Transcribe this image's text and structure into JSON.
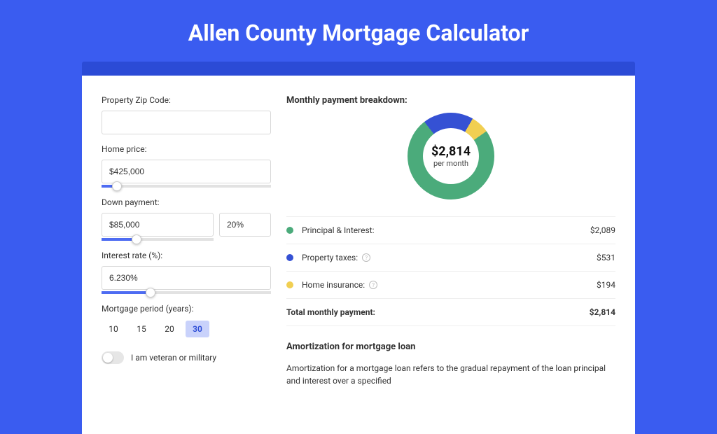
{
  "title": "Allen County Mortgage Calculator",
  "form": {
    "zip": {
      "label": "Property Zip Code:",
      "value": ""
    },
    "home_price": {
      "label": "Home price:",
      "value": "$425,000",
      "slider_pct": 9
    },
    "down_payment": {
      "label": "Down payment:",
      "amount": "$85,000",
      "percent": "20%",
      "slider_pct": 20
    },
    "interest": {
      "label": "Interest rate (%):",
      "value": "6.230%",
      "slider_pct": 29
    },
    "period": {
      "label": "Mortgage period (years):",
      "options": [
        "10",
        "15",
        "20",
        "30"
      ],
      "selected": "30"
    },
    "veteran": {
      "label": "I am veteran or military",
      "checked": false
    }
  },
  "results": {
    "title": "Monthly payment breakdown:",
    "total": "$2,814",
    "total_sub": "per month",
    "items": [
      {
        "label": "Principal & Interest:",
        "value": "$2,089",
        "color": "#4bab7b",
        "info": false
      },
      {
        "label": "Property taxes:",
        "value": "$531",
        "color": "#3551d4",
        "info": true
      },
      {
        "label": "Home insurance:",
        "value": "$194",
        "color": "#f1cf52",
        "info": true
      }
    ],
    "total_row": {
      "label": "Total monthly payment:",
      "value": "$2,814"
    }
  },
  "chart_data": {
    "type": "pie",
    "title": "Monthly payment breakdown",
    "series": [
      {
        "name": "Principal & Interest",
        "value": 2089,
        "color": "#4bab7b"
      },
      {
        "name": "Property taxes",
        "value": 531,
        "color": "#3551d4"
      },
      {
        "name": "Home insurance",
        "value": 194,
        "color": "#f1cf52"
      }
    ],
    "total": 2814,
    "unit": "$/month"
  },
  "amortization": {
    "title": "Amortization for mortgage loan",
    "text": "Amortization for a mortgage loan refers to the gradual repayment of the loan principal and interest over a specified"
  }
}
